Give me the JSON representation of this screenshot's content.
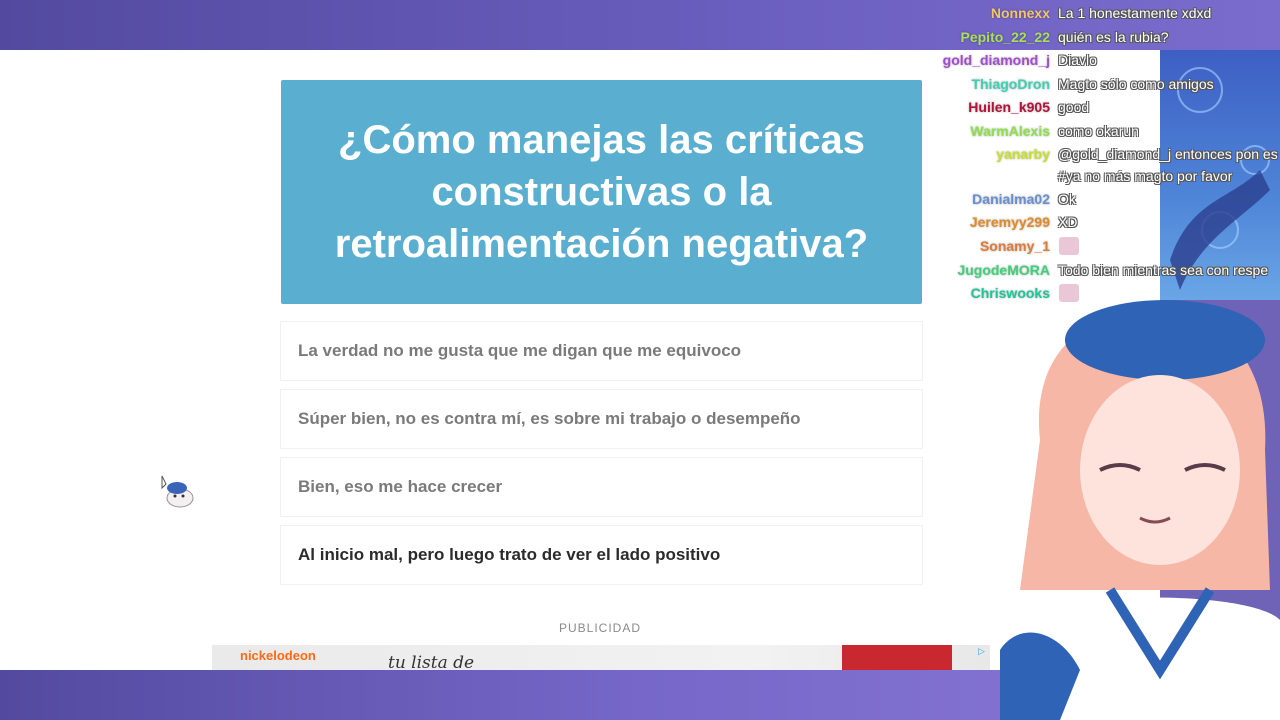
{
  "quiz": {
    "question": "¿Cómo manejas las críticas constructivas o la retroalimentación negativa?",
    "answers": [
      "La verdad no me gusta que me digan que me equivoco",
      "Súper bien, no es contra mí, es sobre mi trabajo o desempeño",
      "Bien, eso me hace crecer",
      "Al inicio mal, pero luego trato de ver el lado positivo"
    ],
    "selected_index": 3
  },
  "ad": {
    "label": "PUBLICIDAD",
    "brand": "nickelodeon",
    "text": "tu lista de"
  },
  "chat": [
    {
      "user": "Nonnexx",
      "color": "#f3c46a",
      "message": "La 1 honestamente xdxd"
    },
    {
      "user": "Pepito_22_22",
      "color": "#a8e05a",
      "message": "quién es la rubia?"
    },
    {
      "user": "gold_diamond_j",
      "color": "#a24cd0",
      "message": "Diavlo"
    },
    {
      "user": "ThiagoDron",
      "color": "#3bd1b5",
      "message": "Magto sólo como amigos"
    },
    {
      "user": "Huilen_k905",
      "color": "#b3123b",
      "message": "good"
    },
    {
      "user": "WarmAlexis",
      "color": "#8de04a",
      "message": "como okarun"
    },
    {
      "user": "yanarby",
      "color": "#c7e02a",
      "message": "@gold_diamond_j entonces pon es"
    },
    {
      "user": "",
      "color": "#ffffff",
      "message": "#ya no más magto por favor"
    },
    {
      "user": "Danialma02",
      "color": "#6a8fd0",
      "message": "Ok"
    },
    {
      "user": "Jeremyy299",
      "color": "#e08a2a",
      "message": "XD"
    },
    {
      "user": "Sonamy_1",
      "color": "#e07a38",
      "message": ""
    },
    {
      "user": "JugodeMORA",
      "color": "#3fd07a",
      "message": "Todo bien mientras sea con respe"
    },
    {
      "user": "Chriswooks",
      "color": "#1fc59a",
      "message": ""
    }
  ]
}
